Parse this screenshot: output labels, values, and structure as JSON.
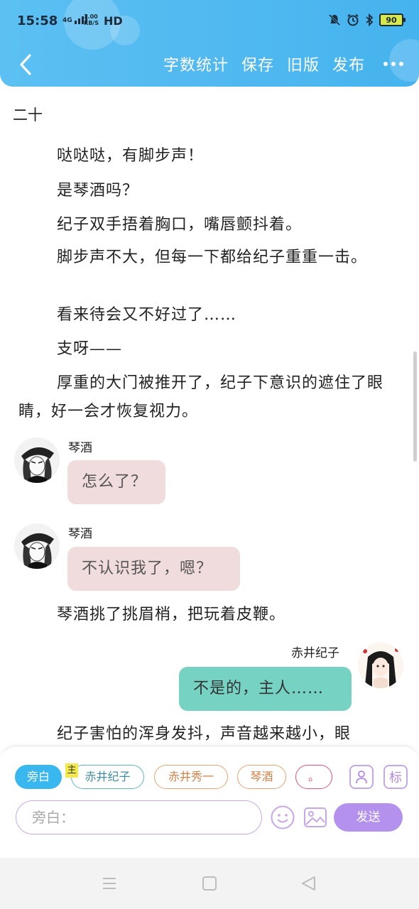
{
  "status_bar": {
    "time": "15:58",
    "network": "4G",
    "speed_value": "3.00",
    "speed_unit": "KB/S",
    "hd": "HD",
    "battery": "90",
    "icons": [
      "mute-icon",
      "alarm-icon",
      "bluetooth-icon",
      "battery-icon"
    ]
  },
  "toolbar": {
    "word_count": "字数统计",
    "save": "保存",
    "old_version": "旧版",
    "publish": "发布"
  },
  "chapter_title": "二十",
  "paragraphs": {
    "p1": "哒哒哒，有脚步声！",
    "p2": "是琴酒吗？",
    "p3": "纪子双手捂着胸口，嘴唇颤抖着。",
    "p4": "脚步声不大，但每一下都给纪子重重一击。",
    "p5": "看来待会又不好过了……",
    "p6": "支呀——",
    "p7": "厚重的大门被推开了，纪子下意识的遮住了眼睛，好一会才恢复视力。",
    "p8": "琴酒挑了挑眉梢，把玩着皮鞭。",
    "p9": "纪子害怕的浑身发抖，声音越来越小，眼"
  },
  "dialogs": {
    "d1": {
      "speaker": "琴酒",
      "text": "怎么了？"
    },
    "d2": {
      "speaker": "琴酒",
      "text": "不认识我了，嗯？"
    },
    "d3": {
      "speaker": "赤井纪子",
      "text": "不是的，主人……"
    }
  },
  "characters": {
    "narration": "旁白",
    "main_tag": "主",
    "c1": "赤井纪子",
    "c2": "赤井秀一",
    "c3": "琴酒",
    "c4": "。",
    "tag_button": "标"
  },
  "input": {
    "placeholder": "旁白："
  },
  "send_label": "发送",
  "colors": {
    "header": "#4fb8f0",
    "pink_bubble": "#f0dcdd",
    "teal_bubble": "#76d2c3",
    "send": "#b391ec"
  }
}
